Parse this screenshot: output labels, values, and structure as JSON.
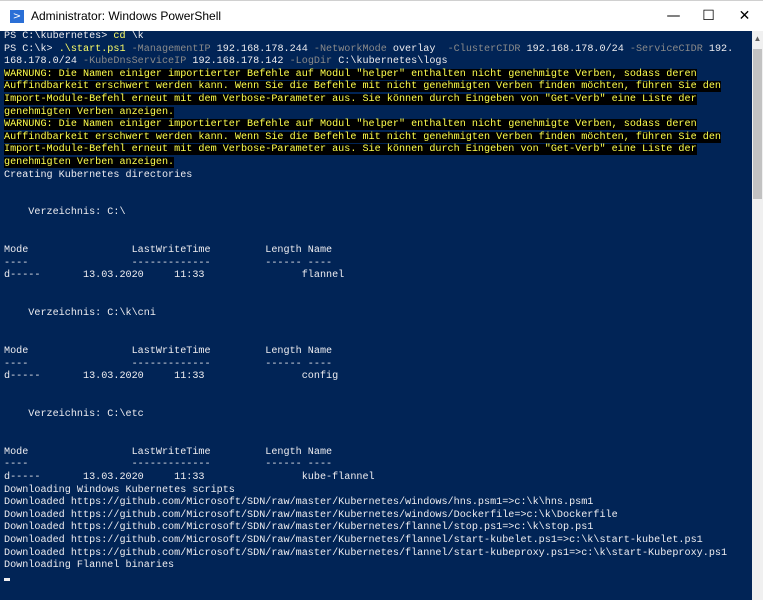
{
  "window": {
    "title": "Administrator: Windows PowerShell",
    "icon": "powershell-icon",
    "minimize": "—",
    "maximize": "☐",
    "close": "✕"
  },
  "colors": {
    "background": "#012456",
    "text": "#eeedf0",
    "warning": "#ffff4d",
    "param": "#8a8a8a"
  },
  "lines": [
    [
      {
        "t": "PS C:\\kubernetes> "
      },
      {
        "t": "cd",
        "c": "cmd"
      },
      {
        "t": " \\k"
      }
    ],
    [
      {
        "t": "PS C:\\k> "
      },
      {
        "t": ".\\start.ps1",
        "c": "cmd"
      },
      {
        "t": " -ManagementIP",
        "c": "param"
      },
      {
        "t": " 192.168.178.244"
      },
      {
        "t": " -NetworkMode",
        "c": "param"
      },
      {
        "t": " overlay "
      },
      {
        "t": " -ClusterCIDR",
        "c": "param"
      },
      {
        "t": " 192.168.178.0/24"
      },
      {
        "t": " -ServiceCIDR",
        "c": "param"
      },
      {
        "t": " 192."
      }
    ],
    [
      {
        "t": "168.178.0/24"
      },
      {
        "t": " -KubeDnsServiceIP",
        "c": "param"
      },
      {
        "t": " 192.168.178.142"
      },
      {
        "t": " -LogDir",
        "c": "param"
      },
      {
        "t": " C:\\kubernetes\\logs"
      }
    ],
    [
      {
        "t": "WARNUNG: Die Namen einiger importierter Befehle auf Modul \"helper\" enthalten nicht genehmigte Verben, sodass deren",
        "c": "warn"
      }
    ],
    [
      {
        "t": "Auffindbarkeit erschwert werden kann. Wenn Sie die Befehle mit nicht genehmigten Verben finden möchten, führen Sie den",
        "c": "warn"
      }
    ],
    [
      {
        "t": "Import-Module-Befehl erneut mit dem Verbose-Parameter aus. Sie können durch Eingeben von \"Get-Verb\" eine Liste der",
        "c": "warn"
      }
    ],
    [
      {
        "t": "genehmigten Verben anzeigen.",
        "c": "warn"
      }
    ],
    [
      {
        "t": "WARNUNG: Die Namen einiger importierter Befehle auf Modul \"helper\" enthalten nicht genehmigte Verben, sodass deren",
        "c": "warn"
      }
    ],
    [
      {
        "t": "Auffindbarkeit erschwert werden kann. Wenn Sie die Befehle mit nicht genehmigten Verben finden möchten, führen Sie den",
        "c": "warn"
      }
    ],
    [
      {
        "t": "Import-Module-Befehl erneut mit dem Verbose-Parameter aus. Sie können durch Eingeben von \"Get-Verb\" eine Liste der",
        "c": "warn"
      }
    ],
    [
      {
        "t": "genehmigten Verben anzeigen.",
        "c": "warn"
      }
    ],
    [
      {
        "t": "Creating Kubernetes directories"
      }
    ],
    [],
    [],
    [
      {
        "t": "    Verzeichnis: C:\\"
      }
    ],
    [],
    [],
    [
      {
        "t": "Mode                 LastWriteTime         Length Name"
      }
    ],
    [
      {
        "t": "----                 -------------         ------ ----"
      }
    ],
    [
      {
        "t": "d-----       13.03.2020     11:33                flannel"
      }
    ],
    [],
    [],
    [
      {
        "t": "    Verzeichnis: C:\\k\\cni"
      }
    ],
    [],
    [],
    [
      {
        "t": "Mode                 LastWriteTime         Length Name"
      }
    ],
    [
      {
        "t": "----                 -------------         ------ ----"
      }
    ],
    [
      {
        "t": "d-----       13.03.2020     11:33                config"
      }
    ],
    [],
    [],
    [
      {
        "t": "    Verzeichnis: C:\\etc"
      }
    ],
    [],
    [],
    [
      {
        "t": "Mode                 LastWriteTime         Length Name"
      }
    ],
    [
      {
        "t": "----                 -------------         ------ ----"
      }
    ],
    [
      {
        "t": "d-----       13.03.2020     11:33                kube-flannel"
      }
    ],
    [
      {
        "t": "Downloading Windows Kubernetes scripts"
      }
    ],
    [
      {
        "t": "Downloaded https://github.com/Microsoft/SDN/raw/master/Kubernetes/windows/hns.psm1=>c:\\k\\hns.psm1"
      }
    ],
    [
      {
        "t": "Downloaded https://github.com/Microsoft/SDN/raw/master/Kubernetes/windows/Dockerfile=>c:\\k\\Dockerfile"
      }
    ],
    [
      {
        "t": "Downloaded https://github.com/Microsoft/SDN/raw/master/Kubernetes/flannel/stop.ps1=>c:\\k\\stop.ps1"
      }
    ],
    [
      {
        "t": "Downloaded https://github.com/Microsoft/SDN/raw/master/Kubernetes/flannel/start-kubelet.ps1=>c:\\k\\start-kubelet.ps1"
      }
    ],
    [
      {
        "t": "Downloaded https://github.com/Microsoft/SDN/raw/master/Kubernetes/flannel/start-kubeproxy.ps1=>c:\\k\\start-Kubeproxy.ps1"
      }
    ],
    [
      {
        "t": "Downloading Flannel binaries"
      }
    ]
  ]
}
